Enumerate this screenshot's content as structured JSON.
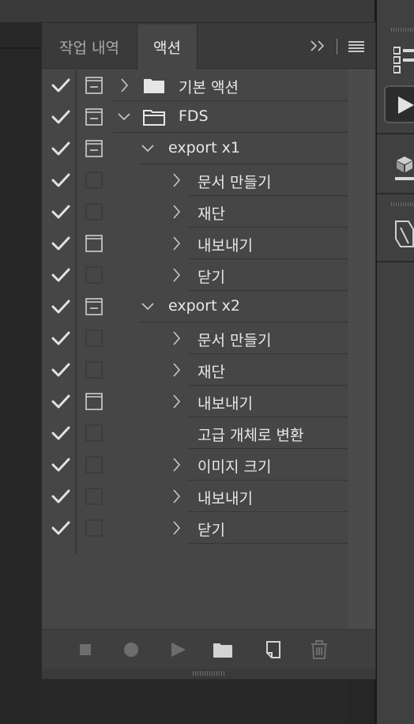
{
  "panel": {
    "tabs": [
      {
        "label": "작업 내역",
        "active": false
      },
      {
        "label": "액션",
        "active": true
      }
    ],
    "expand_glyph": "››",
    "menu_icon": "hamburger-menu-icon"
  },
  "actions": [
    {
      "label": "기본 액션",
      "checked": true,
      "dialog": "on",
      "chevron": "right",
      "folder": "closed"
    },
    {
      "label": "FDS",
      "checked": true,
      "dialog": "on",
      "chevron": "down",
      "folder": "open"
    },
    {
      "label": "export x1",
      "checked": true,
      "dialog": "on",
      "chevron": "down",
      "folder": "none"
    },
    {
      "label": "문서 만들기",
      "checked": true,
      "dialog": "off",
      "chevron": "right"
    },
    {
      "label": "재단",
      "checked": true,
      "dialog": "off",
      "chevron": "right"
    },
    {
      "label": "내보내기",
      "checked": true,
      "dialog": "window",
      "chevron": "right"
    },
    {
      "label": "닫기",
      "checked": true,
      "dialog": "off",
      "chevron": "right"
    },
    {
      "label": "export x2",
      "checked": true,
      "dialog": "on",
      "chevron": "down",
      "folder": "none"
    },
    {
      "label": "문서 만들기",
      "checked": true,
      "dialog": "off",
      "chevron": "right"
    },
    {
      "label": "재단",
      "checked": true,
      "dialog": "off",
      "chevron": "right"
    },
    {
      "label": "내보내기",
      "checked": true,
      "dialog": "window",
      "chevron": "right"
    },
    {
      "label": "고급 개체로 변환",
      "checked": true,
      "dialog": "off",
      "chevron": "none"
    },
    {
      "label": "이미지 크기",
      "checked": true,
      "dialog": "off",
      "chevron": "right"
    },
    {
      "label": "내보내기",
      "checked": true,
      "dialog": "off",
      "chevron": "right"
    },
    {
      "label": "닫기",
      "checked": true,
      "dialog": "off",
      "chevron": "right"
    }
  ],
  "footer": {
    "buttons": [
      "stop-icon",
      "record-icon",
      "play-icon",
      "new-set-folder-icon",
      "new-action-icon",
      "trash-icon"
    ]
  },
  "colors": {
    "panel_bg": "#464646",
    "tab_bar_bg": "#3a3a3a",
    "text": "#e8e8e8",
    "icon": "#cfcfcf",
    "icon_disabled": "#6d6d6d"
  }
}
